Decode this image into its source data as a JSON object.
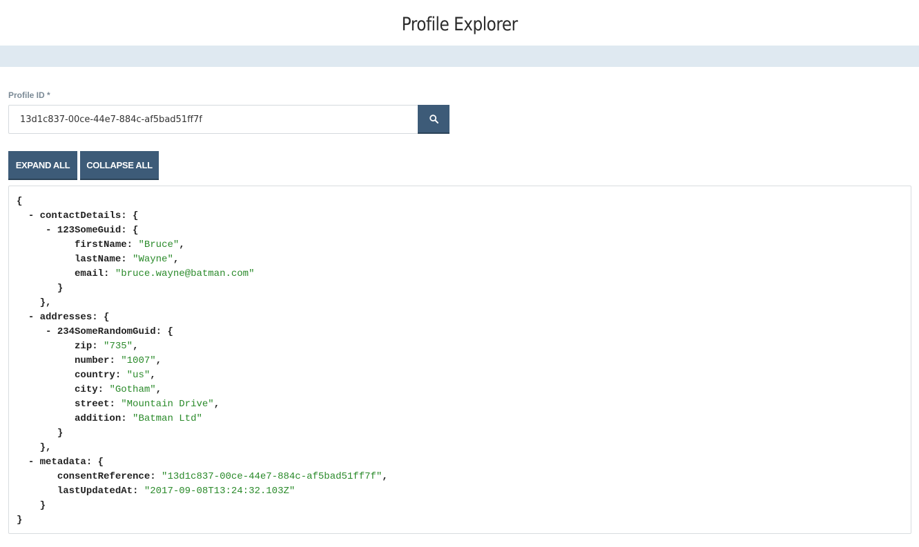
{
  "header": {
    "title": "Profile Explorer"
  },
  "search": {
    "label": "Profile ID *",
    "value": "13d1c837-00ce-44e7-884c-af5bad51ff7f",
    "button_icon": "search-icon"
  },
  "actions": {
    "expand_label": "EXPAND ALL",
    "collapse_label": "COLLAPSE ALL"
  },
  "json": {
    "contactDetails": {
      "key": "contactDetails",
      "entry": {
        "key": "123SomeGuid",
        "firstName": "Bruce",
        "lastName": "Wayne",
        "email": "bruce.wayne@batman.com"
      }
    },
    "addresses": {
      "key": "addresses",
      "entry": {
        "key": "234SomeRandomGuid",
        "zip": "735",
        "number": "1007",
        "country": "us",
        "city": "Gotham",
        "street": "Mountain Drive",
        "addition": "Batman Ltd"
      }
    },
    "metadata": {
      "key": "metadata",
      "consentReference": "13d1c837-00ce-44e7-884c-af5bad51ff7f",
      "lastUpdatedAt": "2017-09-08T13:24:32.103Z"
    }
  },
  "colors": {
    "accent": "#3d5b78",
    "subbar": "#dfe9f1",
    "string": "#2a8a2a"
  }
}
